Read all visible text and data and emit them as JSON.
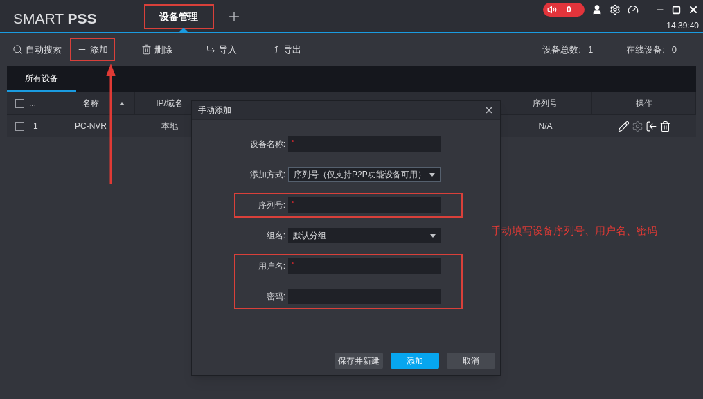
{
  "app": {
    "logo_light": "SMART ",
    "logo_bold": "PSS",
    "clock": "14:39:40",
    "alarm_count": "0"
  },
  "top_tabs": [
    {
      "label": "设备管理",
      "selected": true,
      "highlighted": true
    }
  ],
  "toolbar": [
    {
      "kind": "search",
      "label": "自动搜索",
      "highlighted": false
    },
    {
      "kind": "add",
      "label": "添加",
      "highlighted": true
    },
    {
      "kind": "delete",
      "label": "删除",
      "highlighted": false
    },
    {
      "kind": "import",
      "label": "导入",
      "highlighted": false
    },
    {
      "kind": "export",
      "label": "导出",
      "highlighted": false
    }
  ],
  "stats": [
    {
      "label": "设备总数:",
      "value": "1"
    },
    {
      "label": "在线设备:",
      "value": "0"
    }
  ],
  "sub_tabs": [
    {
      "label": "所有设备",
      "selected": true
    }
  ],
  "table": {
    "select_all_checked": false,
    "index_header": "...",
    "columns": [
      {
        "label": "名称",
        "sorted": true
      },
      {
        "label": "IP/域名",
        "sorted": false
      },
      {
        "label": "序列号",
        "sorted": false
      },
      {
        "label": "操作",
        "sorted": false
      }
    ],
    "rows": [
      {
        "checked": false,
        "index": "1",
        "name": "PC-NVR",
        "ip": "本地",
        "serial": "N/A"
      }
    ]
  },
  "dialog": {
    "title": "手动添加",
    "fields": [
      {
        "kind": "text",
        "label": "设备名称:",
        "required": true,
        "highlighted": false
      },
      {
        "kind": "select",
        "label": "添加方式:",
        "value": "序列号（仅支持P2P功能设备可用）",
        "highlighted": false
      },
      {
        "kind": "text",
        "label": "序列号:",
        "required": true,
        "highlighted": true
      },
      {
        "kind": "select",
        "label": "组名:",
        "value": "默认分组",
        "highlighted": false
      },
      {
        "kind": "text",
        "label": "用户名:",
        "required": true,
        "highlighted": true
      },
      {
        "kind": "text",
        "label": "密码:",
        "required": false,
        "highlighted": true
      }
    ],
    "buttons": [
      {
        "label": "保存并新建",
        "primary": false
      },
      {
        "label": "添加",
        "primary": true
      },
      {
        "label": "取消",
        "primary": false
      }
    ]
  },
  "annotation": {
    "note": "手动填写设备序列号、用户名、密码"
  }
}
